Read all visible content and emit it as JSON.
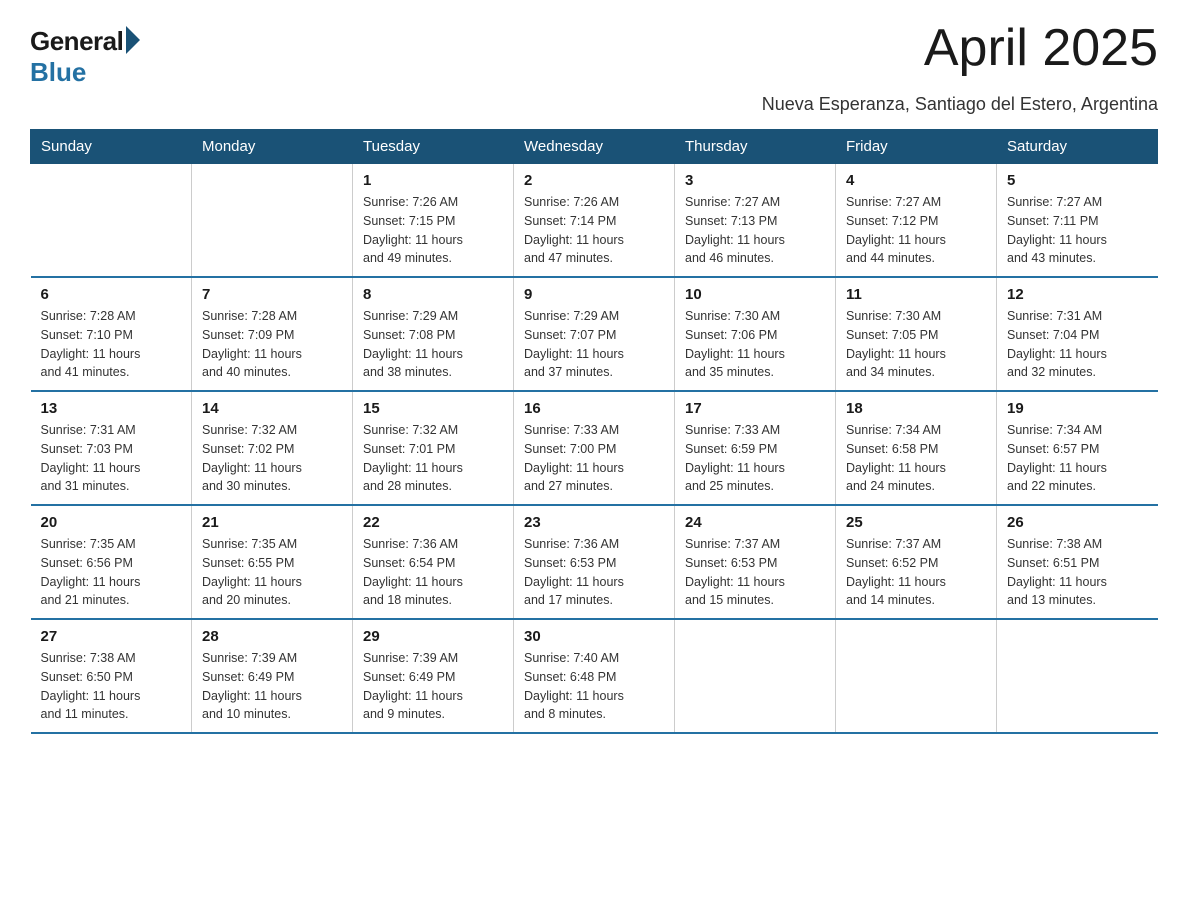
{
  "logo": {
    "general": "General",
    "blue": "Blue"
  },
  "title": "April 2025",
  "location": "Nueva Esperanza, Santiago del Estero, Argentina",
  "days_of_week": [
    "Sunday",
    "Monday",
    "Tuesday",
    "Wednesday",
    "Thursday",
    "Friday",
    "Saturday"
  ],
  "weeks": [
    [
      {
        "day": "",
        "info": ""
      },
      {
        "day": "",
        "info": ""
      },
      {
        "day": "1",
        "info": "Sunrise: 7:26 AM\nSunset: 7:15 PM\nDaylight: 11 hours\nand 49 minutes."
      },
      {
        "day": "2",
        "info": "Sunrise: 7:26 AM\nSunset: 7:14 PM\nDaylight: 11 hours\nand 47 minutes."
      },
      {
        "day": "3",
        "info": "Sunrise: 7:27 AM\nSunset: 7:13 PM\nDaylight: 11 hours\nand 46 minutes."
      },
      {
        "day": "4",
        "info": "Sunrise: 7:27 AM\nSunset: 7:12 PM\nDaylight: 11 hours\nand 44 minutes."
      },
      {
        "day": "5",
        "info": "Sunrise: 7:27 AM\nSunset: 7:11 PM\nDaylight: 11 hours\nand 43 minutes."
      }
    ],
    [
      {
        "day": "6",
        "info": "Sunrise: 7:28 AM\nSunset: 7:10 PM\nDaylight: 11 hours\nand 41 minutes."
      },
      {
        "day": "7",
        "info": "Sunrise: 7:28 AM\nSunset: 7:09 PM\nDaylight: 11 hours\nand 40 minutes."
      },
      {
        "day": "8",
        "info": "Sunrise: 7:29 AM\nSunset: 7:08 PM\nDaylight: 11 hours\nand 38 minutes."
      },
      {
        "day": "9",
        "info": "Sunrise: 7:29 AM\nSunset: 7:07 PM\nDaylight: 11 hours\nand 37 minutes."
      },
      {
        "day": "10",
        "info": "Sunrise: 7:30 AM\nSunset: 7:06 PM\nDaylight: 11 hours\nand 35 minutes."
      },
      {
        "day": "11",
        "info": "Sunrise: 7:30 AM\nSunset: 7:05 PM\nDaylight: 11 hours\nand 34 minutes."
      },
      {
        "day": "12",
        "info": "Sunrise: 7:31 AM\nSunset: 7:04 PM\nDaylight: 11 hours\nand 32 minutes."
      }
    ],
    [
      {
        "day": "13",
        "info": "Sunrise: 7:31 AM\nSunset: 7:03 PM\nDaylight: 11 hours\nand 31 minutes."
      },
      {
        "day": "14",
        "info": "Sunrise: 7:32 AM\nSunset: 7:02 PM\nDaylight: 11 hours\nand 30 minutes."
      },
      {
        "day": "15",
        "info": "Sunrise: 7:32 AM\nSunset: 7:01 PM\nDaylight: 11 hours\nand 28 minutes."
      },
      {
        "day": "16",
        "info": "Sunrise: 7:33 AM\nSunset: 7:00 PM\nDaylight: 11 hours\nand 27 minutes."
      },
      {
        "day": "17",
        "info": "Sunrise: 7:33 AM\nSunset: 6:59 PM\nDaylight: 11 hours\nand 25 minutes."
      },
      {
        "day": "18",
        "info": "Sunrise: 7:34 AM\nSunset: 6:58 PM\nDaylight: 11 hours\nand 24 minutes."
      },
      {
        "day": "19",
        "info": "Sunrise: 7:34 AM\nSunset: 6:57 PM\nDaylight: 11 hours\nand 22 minutes."
      }
    ],
    [
      {
        "day": "20",
        "info": "Sunrise: 7:35 AM\nSunset: 6:56 PM\nDaylight: 11 hours\nand 21 minutes."
      },
      {
        "day": "21",
        "info": "Sunrise: 7:35 AM\nSunset: 6:55 PM\nDaylight: 11 hours\nand 20 minutes."
      },
      {
        "day": "22",
        "info": "Sunrise: 7:36 AM\nSunset: 6:54 PM\nDaylight: 11 hours\nand 18 minutes."
      },
      {
        "day": "23",
        "info": "Sunrise: 7:36 AM\nSunset: 6:53 PM\nDaylight: 11 hours\nand 17 minutes."
      },
      {
        "day": "24",
        "info": "Sunrise: 7:37 AM\nSunset: 6:53 PM\nDaylight: 11 hours\nand 15 minutes."
      },
      {
        "day": "25",
        "info": "Sunrise: 7:37 AM\nSunset: 6:52 PM\nDaylight: 11 hours\nand 14 minutes."
      },
      {
        "day": "26",
        "info": "Sunrise: 7:38 AM\nSunset: 6:51 PM\nDaylight: 11 hours\nand 13 minutes."
      }
    ],
    [
      {
        "day": "27",
        "info": "Sunrise: 7:38 AM\nSunset: 6:50 PM\nDaylight: 11 hours\nand 11 minutes."
      },
      {
        "day": "28",
        "info": "Sunrise: 7:39 AM\nSunset: 6:49 PM\nDaylight: 11 hours\nand 10 minutes."
      },
      {
        "day": "29",
        "info": "Sunrise: 7:39 AM\nSunset: 6:49 PM\nDaylight: 11 hours\nand 9 minutes."
      },
      {
        "day": "30",
        "info": "Sunrise: 7:40 AM\nSunset: 6:48 PM\nDaylight: 11 hours\nand 8 minutes."
      },
      {
        "day": "",
        "info": ""
      },
      {
        "day": "",
        "info": ""
      },
      {
        "day": "",
        "info": ""
      }
    ]
  ]
}
